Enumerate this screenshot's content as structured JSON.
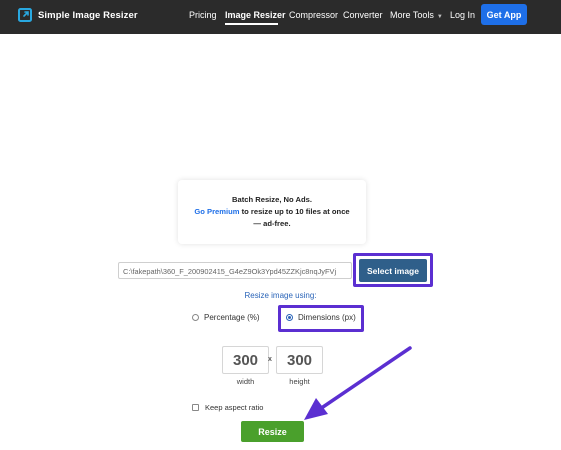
{
  "nav": {
    "brand": "Simple Image Resizer",
    "links": [
      "Pricing",
      "Image Resizer",
      "Compressor",
      "Converter",
      "More Tools"
    ],
    "login": "Log In",
    "get_app": "Get App"
  },
  "promo": {
    "line1": "Batch Resize, No Ads.",
    "premium_link": "Go Premium",
    "line2_rest": " to resize up to 10 files at once",
    "line3": "— ad-free."
  },
  "file": {
    "path": "C:\\fakepath\\360_F_200902415_G4eZ9Ok3Ypd45ZZKjc8nqJyFVj",
    "select_label": "Select image"
  },
  "resize_using": "Resize image using:",
  "options": {
    "percentage": "Percentage (%)",
    "dimensions": "Dimensions (px)",
    "selected": "dimensions"
  },
  "dims": {
    "width": "300",
    "height": "300",
    "times": "x",
    "width_label": "width",
    "height_label": "height"
  },
  "aspect_label": "Keep aspect ratio",
  "resize_label": "Resize",
  "colors": {
    "navbar": "#2b2b2b",
    "accent_blue": "#1e6fe8",
    "select_button": "#2f5f8a",
    "resize_button": "#4aa02c",
    "annotation_purple": "#5b2fd1"
  }
}
